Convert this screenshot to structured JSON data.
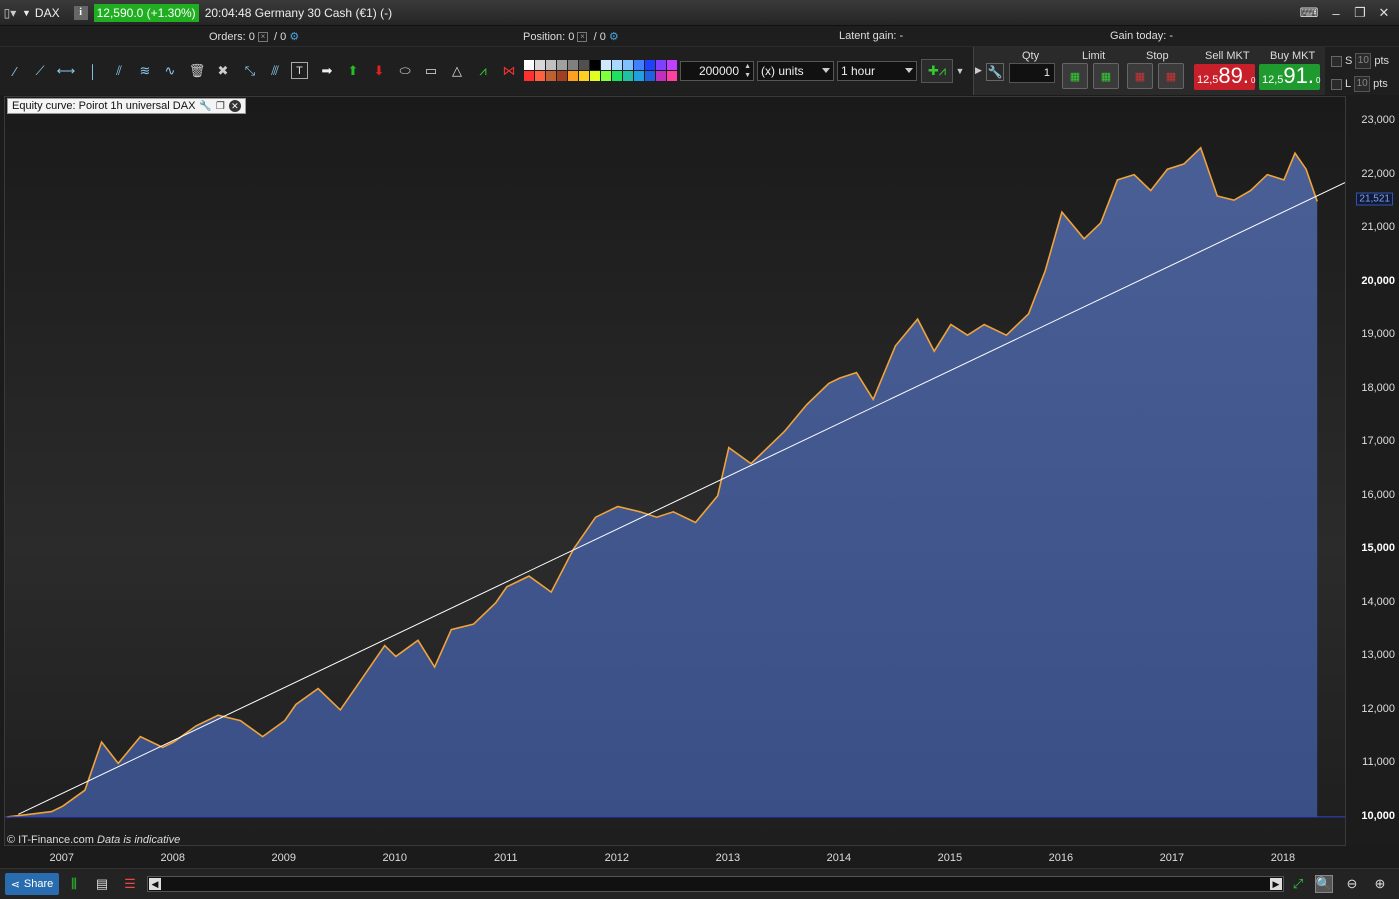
{
  "titlebar": {
    "symbol": "DAX",
    "info": "i",
    "price_change": "12,590.0 (+1.30%)",
    "instrument": "20:04:48 Germany 30 Cash (€1) (-)"
  },
  "status": {
    "orders_label": "Orders:",
    "orders_value1": "0",
    "orders_value2": "0",
    "position_label": "Position:",
    "position_value1": "0",
    "position_value2": "0",
    "latent_gain": "Latent gain: -",
    "gain_today": "Gain today: -"
  },
  "toolbar": {
    "quantity_value": "200000",
    "units_label": "(x) units",
    "timeframe": "1 hour"
  },
  "order_panel": {
    "qty_label": "Qty",
    "qty_value": "1",
    "limit_label": "Limit",
    "stop_label": "Stop",
    "sell_label": "Sell MKT",
    "buy_label": "Buy MKT",
    "sell_small": "12,5",
    "sell_big": "89.",
    "sell_sup": "0",
    "buy_small": "12,5",
    "buy_big": "91.",
    "buy_sup": "0",
    "sell_color": "#c8202a",
    "buy_color": "#1f9a2e"
  },
  "sl_panel": {
    "s_label": "S",
    "l_label": "L",
    "s_pts": "10",
    "l_pts": "10",
    "pts_label": "pts"
  },
  "chart_legend": "Equity curve: Poirot 1h universal DAX",
  "copyright": "© IT-Finance.com",
  "copyright_note": "Data is indicative",
  "share_label": "Share",
  "y_marker": "21,521",
  "chart_data": {
    "type": "area",
    "ylim": [
      9700,
      23300
    ],
    "xlim": [
      2006.48,
      2018.55
    ],
    "baseline": 10000,
    "trendline": [
      [
        2006.6,
        10050
      ],
      [
        2018.55,
        21850
      ]
    ],
    "x": [
      2006.5,
      2006.7,
      2006.9,
      2007.0,
      2007.2,
      2007.35,
      2007.5,
      2007.7,
      2007.9,
      2008.0,
      2008.2,
      2008.4,
      2008.6,
      2008.8,
      2009.0,
      2009.1,
      2009.3,
      2009.5,
      2009.7,
      2009.9,
      2010.0,
      2010.2,
      2010.35,
      2010.5,
      2010.7,
      2010.9,
      2011.0,
      2011.2,
      2011.4,
      2011.6,
      2011.8,
      2012.0,
      2012.2,
      2012.35,
      2012.5,
      2012.7,
      2012.9,
      2013.0,
      2013.2,
      2013.35,
      2013.5,
      2013.7,
      2013.9,
      2014.0,
      2014.15,
      2014.3,
      2014.5,
      2014.7,
      2014.85,
      2015.0,
      2015.15,
      2015.3,
      2015.5,
      2015.7,
      2015.85,
      2016.0,
      2016.2,
      2016.35,
      2016.5,
      2016.65,
      2016.8,
      2016.95,
      2017.1,
      2017.25,
      2017.4,
      2017.55,
      2017.7,
      2017.85,
      2018.0,
      2018.1,
      2018.2,
      2018.3
    ],
    "y": [
      10000,
      10050,
      10100,
      10200,
      10500,
      11400,
      11000,
      11500,
      11300,
      11400,
      11700,
      11900,
      11800,
      11500,
      11800,
      12100,
      12400,
      12000,
      12600,
      13200,
      13000,
      13300,
      12800,
      13500,
      13600,
      14000,
      14300,
      14500,
      14200,
      15000,
      15600,
      15800,
      15700,
      15600,
      15700,
      15500,
      16000,
      16900,
      16600,
      16900,
      17200,
      17700,
      18100,
      18200,
      18300,
      17800,
      18800,
      19300,
      18700,
      19200,
      19000,
      19200,
      19000,
      19400,
      20200,
      21300,
      20800,
      21100,
      21900,
      22000,
      21700,
      22100,
      22200,
      22500,
      21600,
      21521,
      21700,
      22000,
      21900,
      22400,
      22100,
      21500
    ]
  }
}
